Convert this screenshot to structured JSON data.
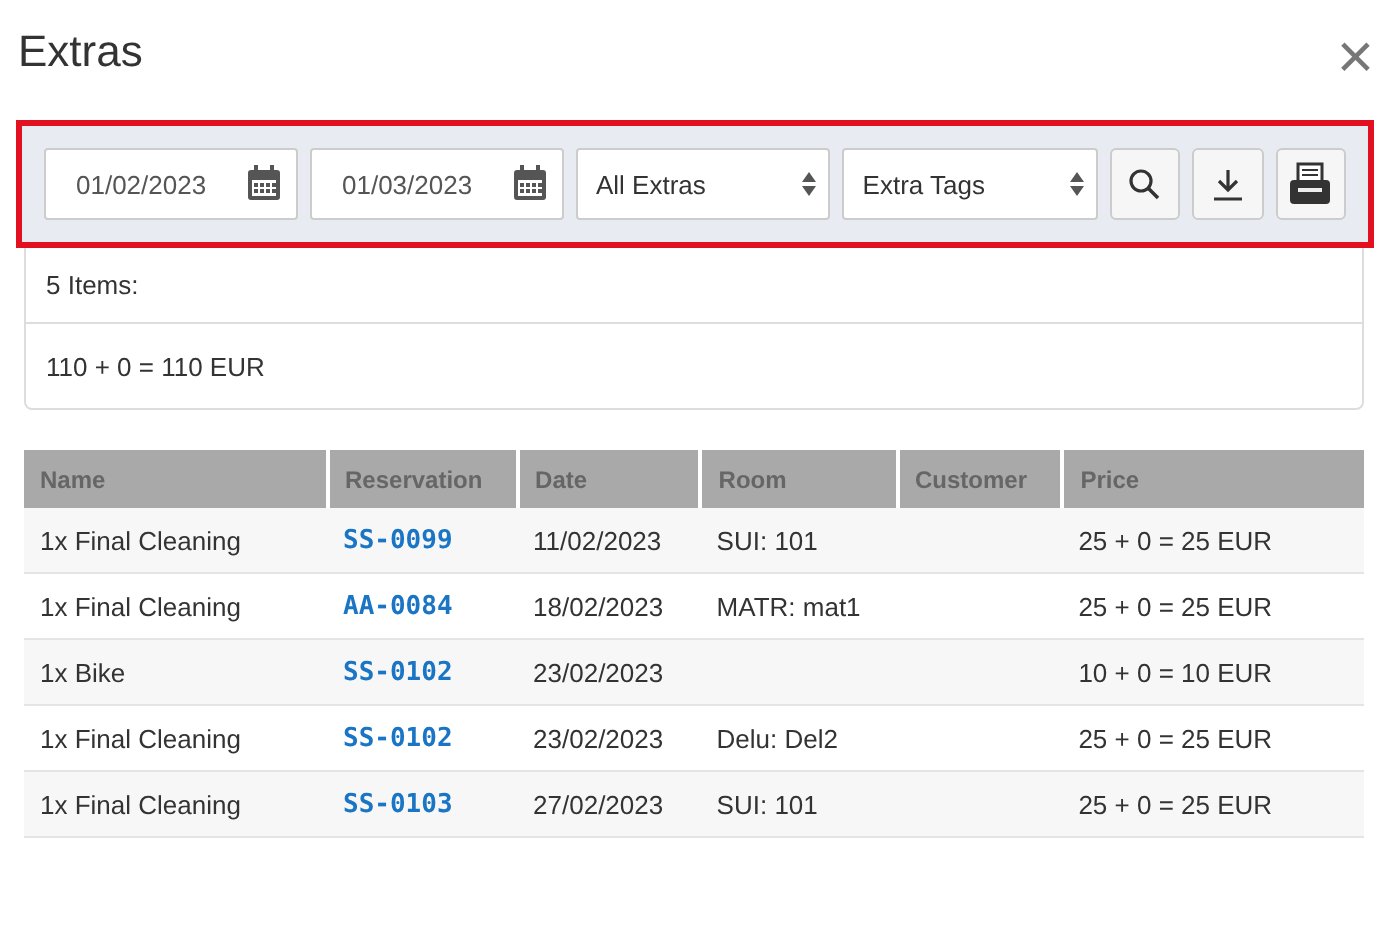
{
  "window": {
    "title": "Extras",
    "close": "×"
  },
  "filters": {
    "date_from": "01/02/2023",
    "date_to": "01/03/2023",
    "extras_select": "All Extras",
    "tags_select": "Extra Tags",
    "highlighted": true
  },
  "summary": {
    "count": "5 Items:",
    "total": "110 + 0 = 110 EUR"
  },
  "table": {
    "columns": [
      "Name",
      "Reservation",
      "Date",
      "Room",
      "Customer",
      "Price"
    ],
    "rows": [
      {
        "name": "1x Final Cleaning",
        "reservation": "SS-0099",
        "date": "11/02/2023",
        "room": "SUI: 101",
        "customer": "",
        "price": "25 + 0 = 25 EUR"
      },
      {
        "name": "1x Final Cleaning",
        "reservation": "AA-0084",
        "date": "18/02/2023",
        "room": "MATR: mat1",
        "customer": "",
        "price": "25 + 0 = 25 EUR"
      },
      {
        "name": "1x Bike",
        "reservation": "SS-0102",
        "date": "23/02/2023",
        "room": "",
        "customer": "",
        "price": "10 + 0 = 10 EUR"
      },
      {
        "name": "1x Final Cleaning",
        "reservation": "SS-0102",
        "date": "23/02/2023",
        "room": "Delu: Del2",
        "customer": "",
        "price": "25 + 0 = 25 EUR"
      },
      {
        "name": "1x Final Cleaning",
        "reservation": "SS-0103",
        "date": "27/02/2023",
        "room": "SUI: 101",
        "customer": "",
        "price": "25 + 0 = 25 EUR"
      }
    ]
  }
}
